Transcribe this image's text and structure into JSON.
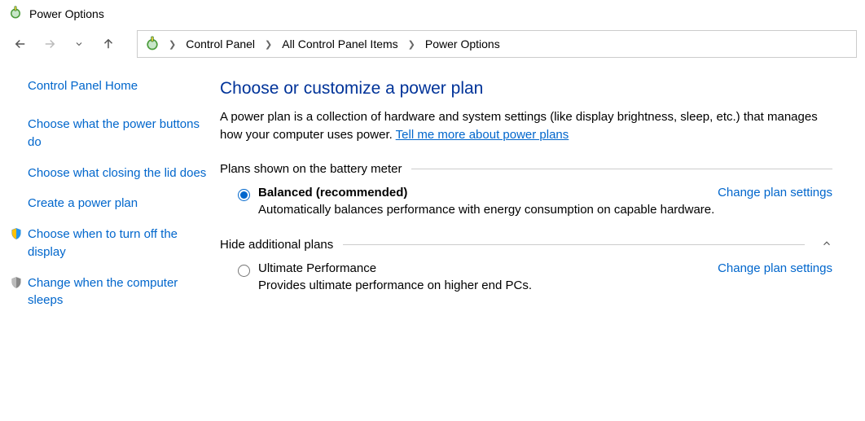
{
  "window": {
    "title": "Power Options"
  },
  "breadcrumb": {
    "items": [
      "Control Panel",
      "All Control Panel Items",
      "Power Options"
    ]
  },
  "sidebar": {
    "home": "Control Panel Home",
    "links": [
      "Choose what the power buttons do",
      "Choose what closing the lid does",
      "Create a power plan",
      "Choose when to turn off the display",
      "Change when the computer sleeps"
    ]
  },
  "main": {
    "heading": "Choose or customize a power plan",
    "description_pre": "A power plan is a collection of hardware and system settings (like display brightness, sleep, etc.) that manages how your computer uses power. ",
    "description_link": "Tell me more about power plans",
    "group1_label": "Plans shown on the battery meter",
    "group2_label": "Hide additional plans",
    "change_label": "Change plan settings",
    "plans": {
      "balanced": {
        "name": "Balanced (recommended)",
        "desc": "Automatically balances performance with energy consumption on capable hardware."
      },
      "ultimate": {
        "name": "Ultimate Performance",
        "desc": "Provides ultimate performance on higher end PCs."
      }
    }
  }
}
